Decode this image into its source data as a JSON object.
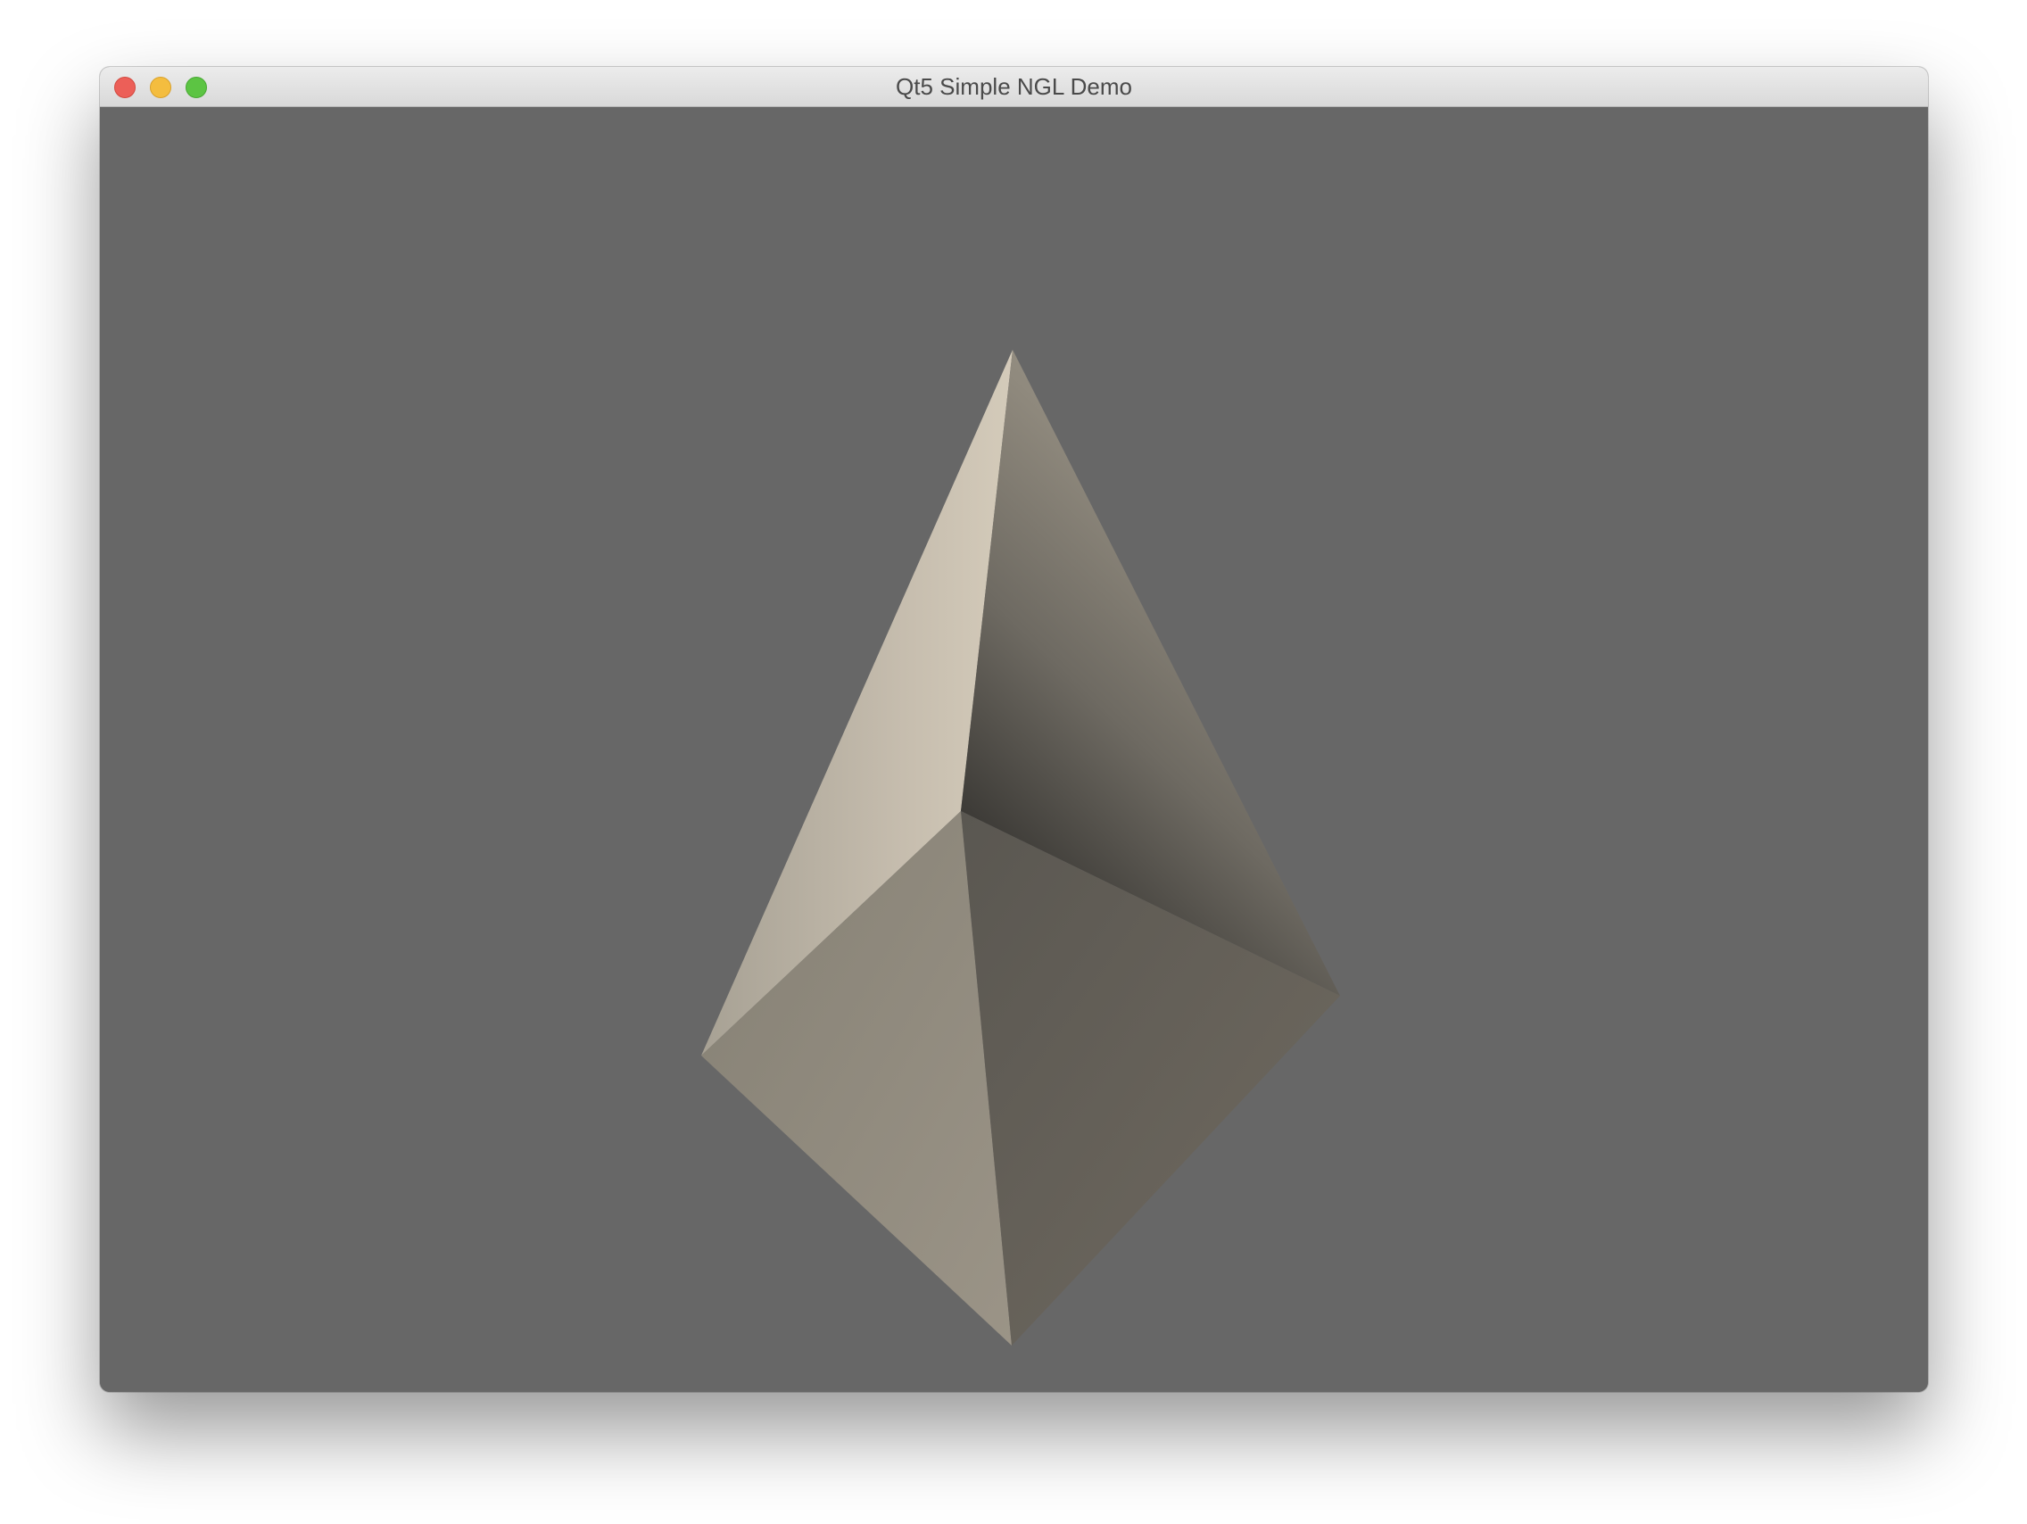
{
  "window": {
    "title": "Qt5 Simple NGL Demo",
    "controls": {
      "close": "close-icon",
      "minimize": "minimize-icon",
      "zoom": "zoom-icon"
    }
  },
  "viewport": {
    "background_color": "#676767",
    "object": "tetrahedron-model",
    "face_colors": {
      "left_face": "#cfc6b6",
      "right_face": "#8a857b",
      "bottom_left_face": "#928c80",
      "bottom_right_face": "#676259"
    }
  }
}
